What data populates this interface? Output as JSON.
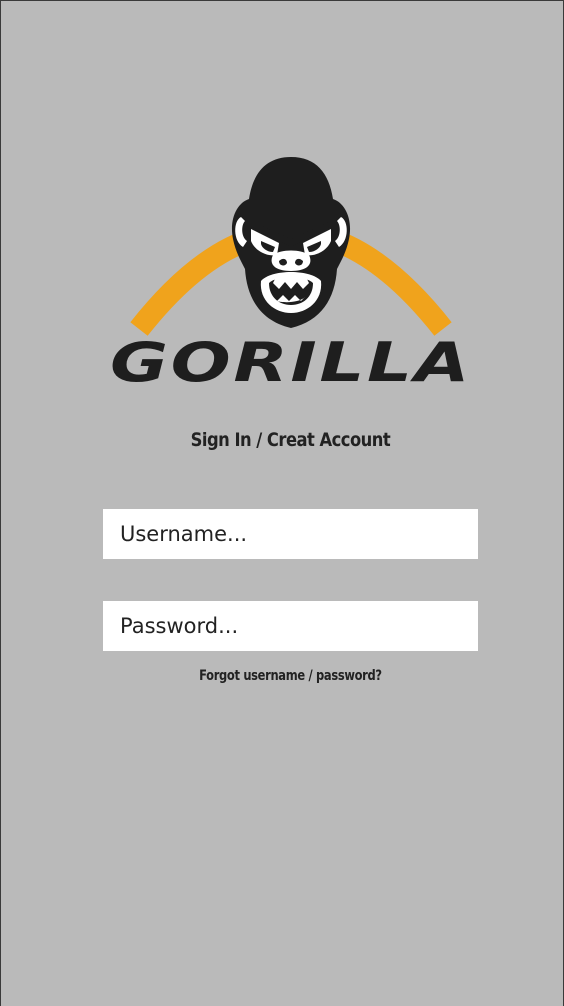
{
  "brand": {
    "name": "GORILLA",
    "logo_icon": "gorilla-head-icon",
    "arch_color": "#f0a31c",
    "ink_color": "#1e1e1e"
  },
  "auth": {
    "heading": "Sign In / Creat Account",
    "username_placeholder": "Username...",
    "password_placeholder": "Password...",
    "forgot_link": "Forgot username / password?"
  },
  "colors": {
    "background": "#bababa",
    "field_background": "#ffffff",
    "text": "#222222"
  }
}
